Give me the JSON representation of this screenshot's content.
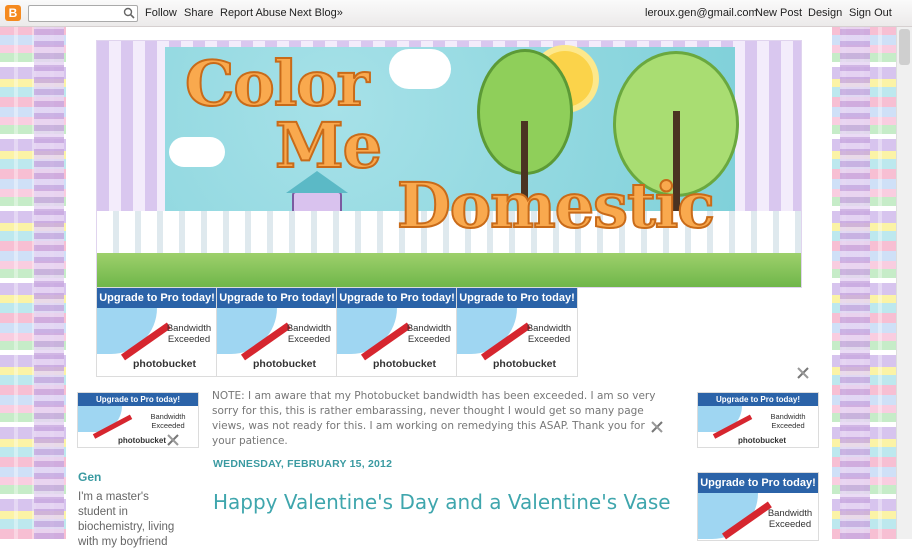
{
  "navbar": {
    "search_placeholder": "",
    "links": [
      "Follow",
      "Share",
      "Report Abuse",
      "Next Blog»"
    ],
    "account_email": "leroux.gen@gmail.com",
    "right_links": [
      "New Post",
      "Design",
      "Sign Out"
    ]
  },
  "header": {
    "title_lines": [
      "Color",
      "Me",
      "Domestic"
    ]
  },
  "badge": {
    "head": "Upgrade to Pro today!",
    "line1": "Bandwidth",
    "line2": "Exceeded",
    "brand": "photobucket"
  },
  "note": "NOTE: I am aware that my Photobucket bandwidth has been exceeded. I am so very sorry for this, this is rather embarassing, never thought I would get so many page views, was not ready for this. I am working on remedying this ASAP. Thank you for your patience.",
  "post": {
    "date": "WEDNESDAY, FEBRUARY 15, 2012",
    "title": "Happy Valentine's Day and a Valentine's Vase"
  },
  "profile": {
    "name": "Gen",
    "about": "I'm a master's student in biochemistry, living with my boyfriend"
  },
  "colors": {
    "accent": "#3a9aa1",
    "badge_blue": "#2b63a8",
    "blogger_orange": "#f58a1f"
  },
  "icons": {
    "logo": "blogger-logo-icon",
    "search": "search-icon",
    "edit": "wrench-screwdriver-icon"
  }
}
